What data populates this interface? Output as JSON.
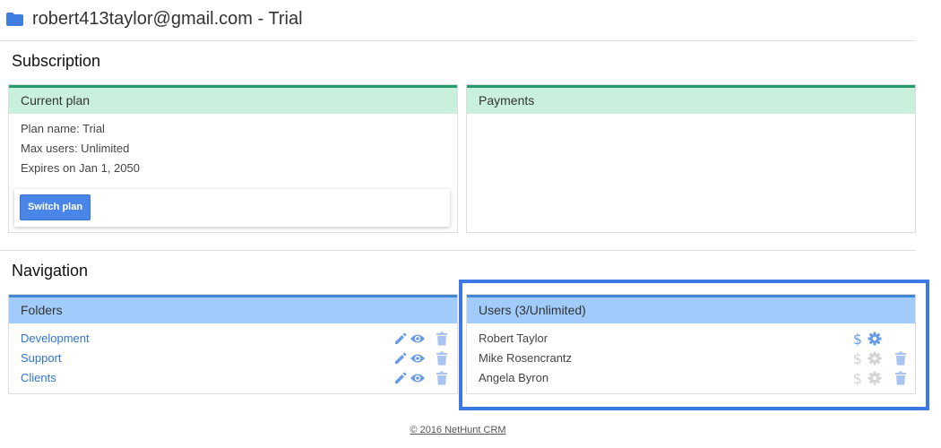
{
  "header": {
    "title": "robert413taylor@gmail.com - Trial",
    "icon": "folder-icon"
  },
  "subscription": {
    "title": "Subscription",
    "current_plan": {
      "heading": "Current plan",
      "plan_name": "Plan name: Trial",
      "max_users": "Max users: Unlimited",
      "expires": "Expires on Jan 1, 2050",
      "switch_button": "Switch plan"
    },
    "payments": {
      "heading": "Payments"
    }
  },
  "navigation": {
    "title": "Navigation",
    "folders": {
      "heading": "Folders",
      "items": [
        {
          "name": "Development"
        },
        {
          "name": "Support"
        },
        {
          "name": "Clients"
        }
      ]
    },
    "users": {
      "heading": "Users (3/Unlimited)",
      "items": [
        {
          "name": "Robert Taylor",
          "enabled": true,
          "deletable": false
        },
        {
          "name": "Mike Rosencrantz",
          "enabled": false,
          "deletable": true
        },
        {
          "name": "Angela Byron",
          "enabled": false,
          "deletable": true
        }
      ]
    }
  },
  "footer": {
    "text": "© 2016 NetHunt CRM"
  },
  "colors": {
    "accent": "#4a86e8",
    "link": "#2f74d0",
    "green_header": "#c9f0dc",
    "blue_header": "#a0cbfa",
    "highlight": "#3d78e6",
    "icon_active": "#6a9be8",
    "icon_disabled": "#d4d4d4",
    "trash": "#a9c4f0"
  }
}
